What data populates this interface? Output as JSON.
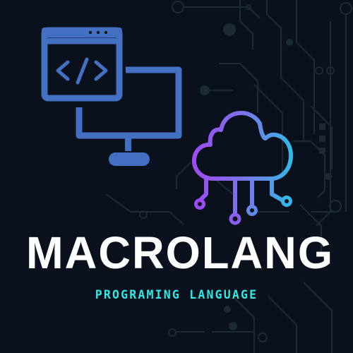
{
  "brand": {
    "title": "MACROLANG",
    "tagline": "PROGRAMING LANGUAGE"
  },
  "icons": {
    "window": "browser-code-window-icon",
    "monitor": "monitor-icon",
    "cloud": "cloud-network-icon",
    "background": "circuit-board-pattern"
  },
  "colors": {
    "background": "#0a111d",
    "circuit": "#1c2b35",
    "window_blue": "#4470c4",
    "cloud_purple": "#9b4df0",
    "cloud_cyan": "#35b6e6",
    "title": "#ffffff",
    "tagline": "#2ee8e2"
  }
}
